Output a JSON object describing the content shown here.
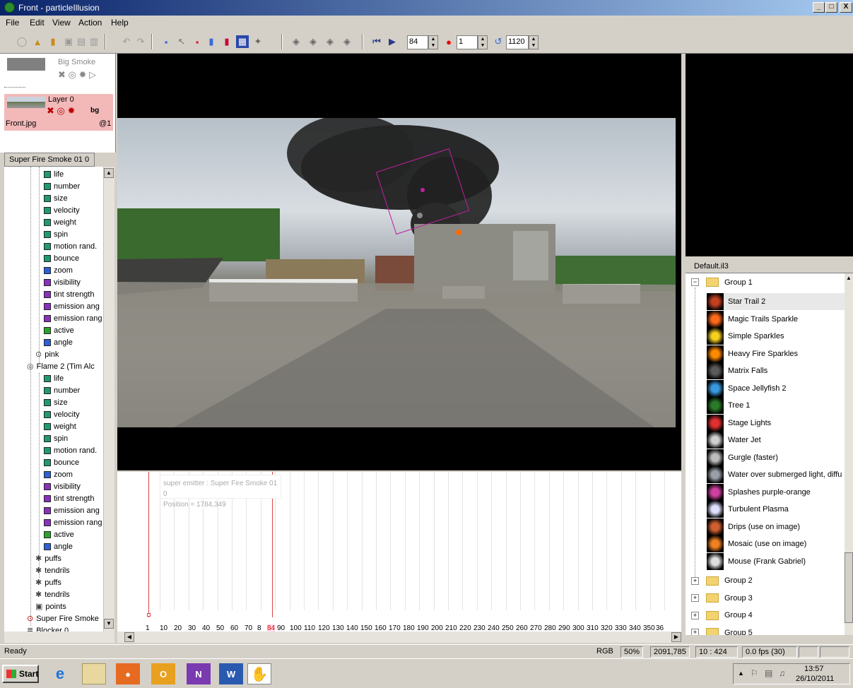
{
  "window": {
    "title": "Front - particleIllusion",
    "min": "_",
    "max": "□",
    "close": "X"
  },
  "menu": [
    "File",
    "Edit",
    "View",
    "Action",
    "Help"
  ],
  "toolbar": {
    "frame": "84",
    "record_frame": "1",
    "end_frame": "1120"
  },
  "layers": [
    {
      "name": "Big Smoke"
    },
    {
      "name": "Layer 0",
      "file": "Front.jpg",
      "at": "@1",
      "bg": "bg"
    }
  ],
  "tree": {
    "header": "Super Fire Smoke 01 0",
    "items": [
      {
        "label": "life",
        "color": "#1f9b6f",
        "indent": 56
      },
      {
        "label": "number",
        "color": "#1f9b6f",
        "indent": 56
      },
      {
        "label": "size",
        "color": "#1f9b6f",
        "indent": 56
      },
      {
        "label": "velocity",
        "color": "#1f9b6f",
        "indent": 56
      },
      {
        "label": "weight",
        "color": "#1f9b6f",
        "indent": 56
      },
      {
        "label": "spin",
        "color": "#1f9b6f",
        "indent": 56
      },
      {
        "label": "motion rand.",
        "color": "#1f9b6f",
        "indent": 56
      },
      {
        "label": "bounce",
        "color": "#1f9b6f",
        "indent": 56
      },
      {
        "label": "zoom",
        "color": "#2d62d6",
        "indent": 56
      },
      {
        "label": "visibility",
        "color": "#8c2fbf",
        "indent": 56
      },
      {
        "label": "tint strength",
        "color": "#8c2fbf",
        "indent": 56
      },
      {
        "label": "emission ang",
        "color": "#8c2fbf",
        "indent": 56
      },
      {
        "label": "emission ranɡ",
        "color": "#8c2fbf",
        "indent": 56
      },
      {
        "label": "active",
        "color": "#2aa52a",
        "indent": 56
      },
      {
        "label": "angle",
        "color": "#2d62d6",
        "indent": 56
      },
      {
        "label": "pink",
        "icon": "⊙",
        "indent": 44
      },
      {
        "label": "Flame 2 (Tim Alc",
        "icon": "◎",
        "indent": 32
      },
      {
        "label": "life",
        "color": "#1f9b6f",
        "indent": 56
      },
      {
        "label": "number",
        "color": "#1f9b6f",
        "indent": 56
      },
      {
        "label": "size",
        "color": "#1f9b6f",
        "indent": 56
      },
      {
        "label": "velocity",
        "color": "#1f9b6f",
        "indent": 56
      },
      {
        "label": "weight",
        "color": "#1f9b6f",
        "indent": 56
      },
      {
        "label": "spin",
        "color": "#1f9b6f",
        "indent": 56
      },
      {
        "label": "motion rand.",
        "color": "#1f9b6f",
        "indent": 56
      },
      {
        "label": "bounce",
        "color": "#1f9b6f",
        "indent": 56
      },
      {
        "label": "zoom",
        "color": "#2d62d6",
        "indent": 56
      },
      {
        "label": "visibility",
        "color": "#8c2fbf",
        "indent": 56
      },
      {
        "label": "tint strength",
        "color": "#8c2fbf",
        "indent": 56
      },
      {
        "label": "emission ang",
        "color": "#8c2fbf",
        "indent": 56
      },
      {
        "label": "emission ranɡ",
        "color": "#8c2fbf",
        "indent": 56
      },
      {
        "label": "active",
        "color": "#2aa52a",
        "indent": 56
      },
      {
        "label": "angle",
        "color": "#2d62d6",
        "indent": 56
      },
      {
        "label": "puffs",
        "icon": "✱",
        "indent": 44
      },
      {
        "label": "tendrils",
        "icon": "✱",
        "indent": 44
      },
      {
        "label": "puffs",
        "icon": "✱",
        "indent": 44
      },
      {
        "label": "tendrils",
        "icon": "✱",
        "indent": 44
      },
      {
        "label": "points",
        "icon": "▣",
        "indent": 44
      },
      {
        "label": "Super Fire Smokе",
        "icon": "⊙",
        "indent": 32
      },
      {
        "label": "Blocker 0",
        "icon": "≣",
        "indent": 32
      }
    ]
  },
  "timeline": {
    "emitter_label": "super emitter : Super Fire Smoke 01 0",
    "position": "Position = 1784,349",
    "current_frame": "84",
    "ticks": [
      "1",
      "10",
      "20",
      "30",
      "40",
      "50",
      "60",
      "70",
      "8",
      "84",
      "90",
      "100",
      "110",
      "120",
      "130",
      "140",
      "150",
      "160",
      "170",
      "180",
      "190",
      "200",
      "210",
      "220",
      "230",
      "240",
      "250",
      "260",
      "270",
      "280",
      "290",
      "300",
      "310",
      "320",
      "330",
      "340",
      "350",
      "36"
    ]
  },
  "presets": {
    "file": "Default.il3",
    "group_open": "Group 1",
    "items": [
      {
        "name": "Star Trail 2",
        "thumb": "#c04020"
      },
      {
        "name": "Magic Trails Sparkle",
        "thumb": "#ff6a1a"
      },
      {
        "name": "Simple Sparkles",
        "thumb": "#f5d020"
      },
      {
        "name": "Heavy Fire Sparkles",
        "thumb": "#ff8a00"
      },
      {
        "name": "Matrix Falls",
        "thumb": "#5a5a5a"
      },
      {
        "name": "Space Jellyfish 2",
        "thumb": "#3a9ae0"
      },
      {
        "name": "Tree 1",
        "thumb": "#2a7a2a"
      },
      {
        "name": "Stage Lights",
        "thumb": "#e03030"
      },
      {
        "name": "Water Jet",
        "thumb": "#d0d0d0"
      },
      {
        "name": "Gurgle (faster)",
        "thumb": "#bcbcbc"
      },
      {
        "name": "Water over submerged light, diffu",
        "thumb": "#9aa0a8"
      },
      {
        "name": "Splashes purple-orange",
        "thumb": "#d040a0"
      },
      {
        "name": "Turbulent Plasma",
        "thumb": "#e0e0ff"
      },
      {
        "name": "Drips (use on image)",
        "thumb": "#d06030"
      },
      {
        "name": "Mosaic (use on image)",
        "thumb": "#f08020"
      },
      {
        "name": "Mouse (Frank Gabriel)",
        "thumb": "#e0e0e0"
      }
    ],
    "groups_closed": [
      "Group 2",
      "Group 3",
      "Group 4",
      "Group 5"
    ]
  },
  "status": {
    "ready": "Ready",
    "mode": "RGB",
    "zoom": "50%",
    "coords": "2091,785",
    "ratio": "10 : 424",
    "fps": "0.0 fps (30)"
  },
  "taskbar": {
    "start": "Start",
    "time": "13:57",
    "date": "26/10/2011"
  }
}
